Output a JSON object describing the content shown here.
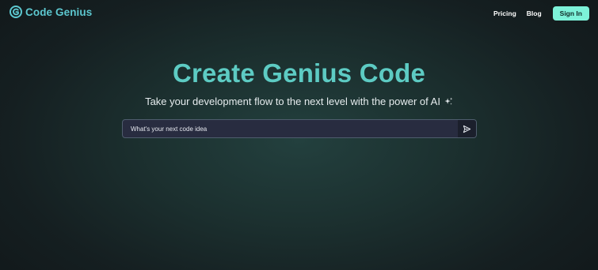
{
  "brand": {
    "name": "Code Genius",
    "logo_icon": "code-genius-logo-icon",
    "color": "#5dc8d0"
  },
  "nav": {
    "links": [
      {
        "label": "Pricing"
      },
      {
        "label": "Blog"
      }
    ],
    "signin_label": "Sign In",
    "signin_color": "#7df2d9"
  },
  "hero": {
    "title": "Create Genius Code",
    "subtitle": "Take your development flow to the next level with the power of AI",
    "sparkle_icon": "sparkle-icon",
    "title_color": "#5dcbc3"
  },
  "prompt": {
    "placeholder": "What's your next code idea",
    "value": "",
    "send_icon": "send-icon"
  },
  "colors": {
    "background": "#1c3130",
    "input_background": "#282c40"
  }
}
